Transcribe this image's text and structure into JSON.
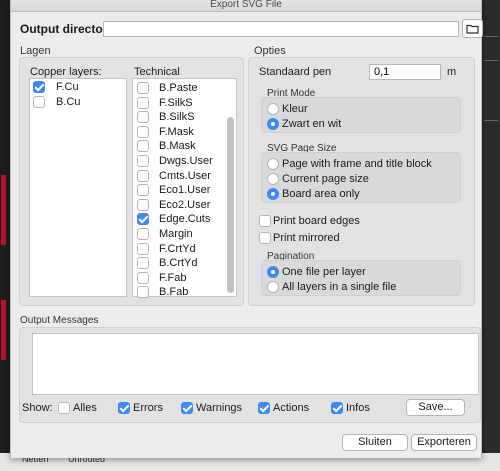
{
  "window": {
    "title": "Export SVG File"
  },
  "output": {
    "label": "Output directory:",
    "value": ""
  },
  "icons": {
    "folder": "folder-icon"
  },
  "lagen": {
    "title": "Lagen",
    "copper_title": "Copper layers:",
    "copper": [
      {
        "label": "F.Cu",
        "checked": true
      },
      {
        "label": "B.Cu",
        "checked": false
      }
    ],
    "technical_title": "Technical",
    "technical": [
      {
        "label": "B.Paste",
        "checked": false
      },
      {
        "label": "F.SilkS",
        "checked": false
      },
      {
        "label": "B.SilkS",
        "checked": false
      },
      {
        "label": "F.Mask",
        "checked": false
      },
      {
        "label": "B.Mask",
        "checked": false
      },
      {
        "label": "Dwgs.User",
        "checked": false
      },
      {
        "label": "Cmts.User",
        "checked": false
      },
      {
        "label": "Eco1.User",
        "checked": false
      },
      {
        "label": "Eco2.User",
        "checked": false
      },
      {
        "label": "Edge.Cuts",
        "checked": true
      },
      {
        "label": "Margin",
        "checked": false
      },
      {
        "label": "F.CrtYd",
        "checked": false
      },
      {
        "label": "B.CrtYd",
        "checked": false
      },
      {
        "label": "F.Fab",
        "checked": false
      },
      {
        "label": "B.Fab",
        "checked": false
      }
    ]
  },
  "opties": {
    "title": "Opties",
    "pen_label": "Standaard pen",
    "pen_value": "0,1",
    "pen_unit": "m",
    "print_mode": {
      "title": "Print Mode",
      "options": [
        "Kleur",
        "Zwart en wit"
      ],
      "selected": 1
    },
    "page_size": {
      "title": "SVG Page Size",
      "options": [
        "Page with frame and title block",
        "Current page size",
        "Board area only"
      ],
      "selected": 2
    },
    "print_board_edges": {
      "label": "Print board edges",
      "checked": false
    },
    "print_mirrored": {
      "label": "Print mirrored",
      "checked": false
    },
    "pagination": {
      "title": "Pagination",
      "options": [
        "One file per layer",
        "All layers in a single file"
      ],
      "selected": 0
    }
  },
  "messages": {
    "title": "Output Messages",
    "show_label": "Show:",
    "filters": [
      {
        "label": "Alles",
        "checked": false
      },
      {
        "label": "Errors",
        "checked": true
      },
      {
        "label": "Warnings",
        "checked": true
      },
      {
        "label": "Actions",
        "checked": true
      },
      {
        "label": "Infos",
        "checked": true
      }
    ],
    "save_label": "Save..."
  },
  "buttons": {
    "close": "Sluiten",
    "export": "Exporteren"
  },
  "statusbar": {
    "netten": "Netten",
    "unrouted": "Unrouted"
  }
}
